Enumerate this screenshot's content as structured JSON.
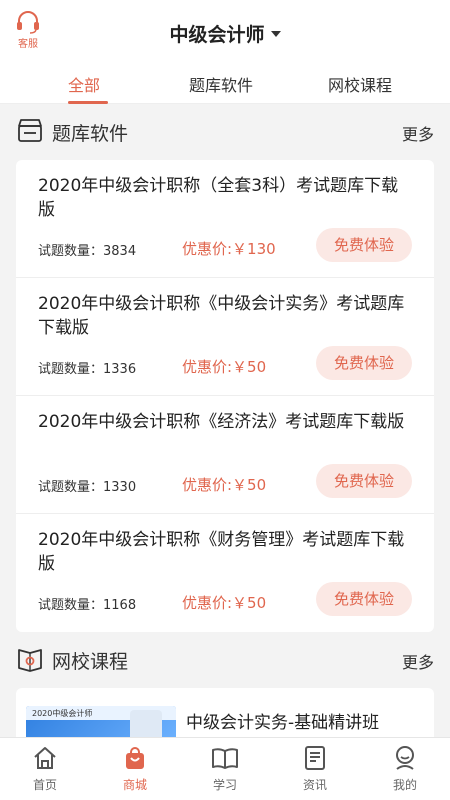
{
  "header": {
    "service_label": "客服",
    "title": "中级会计师"
  },
  "tabs": [
    {
      "label": "全部",
      "active": true
    },
    {
      "label": "题库软件",
      "active": false
    },
    {
      "label": "网校课程",
      "active": false
    }
  ],
  "question_bank": {
    "title": "题库软件",
    "more": "更多",
    "items": [
      {
        "title": "2020年中级会计职称（全套3科）考试题库下载版",
        "count": "试题数量：3834",
        "price": "优惠价:￥130",
        "button": "免费体验"
      },
      {
        "title": "2020年中级会计职称《中级会计实务》考试题库下载版",
        "count": "试题数量：1336",
        "price": "优惠价:￥50",
        "button": "免费体验"
      },
      {
        "title": "2020年中级会计职称《经济法》考试题库下载版",
        "count": "试题数量：1330",
        "price": "优惠价:￥50",
        "button": "免费体验"
      },
      {
        "title": "2020年中级会计职称《财务管理》考试题库下载版",
        "count": "试题数量：1168",
        "price": "优惠价:￥50",
        "button": "免费体验"
      }
    ]
  },
  "courses": {
    "title": "网校课程",
    "more": "更多",
    "first_course_title": "中级会计实务-基础精讲班",
    "thumb_text": "2020中级会计师"
  },
  "nav": [
    {
      "label": "首页",
      "icon": "home-icon",
      "active": false
    },
    {
      "label": "商城",
      "icon": "shopping-bag-icon",
      "active": true
    },
    {
      "label": "学习",
      "icon": "book-icon",
      "active": false
    },
    {
      "label": "资讯",
      "icon": "news-icon",
      "active": false
    },
    {
      "label": "我的",
      "icon": "profile-icon",
      "active": false
    }
  ],
  "colors": {
    "accent": "#e0664e",
    "accent_bg": "#fbe8e4"
  }
}
